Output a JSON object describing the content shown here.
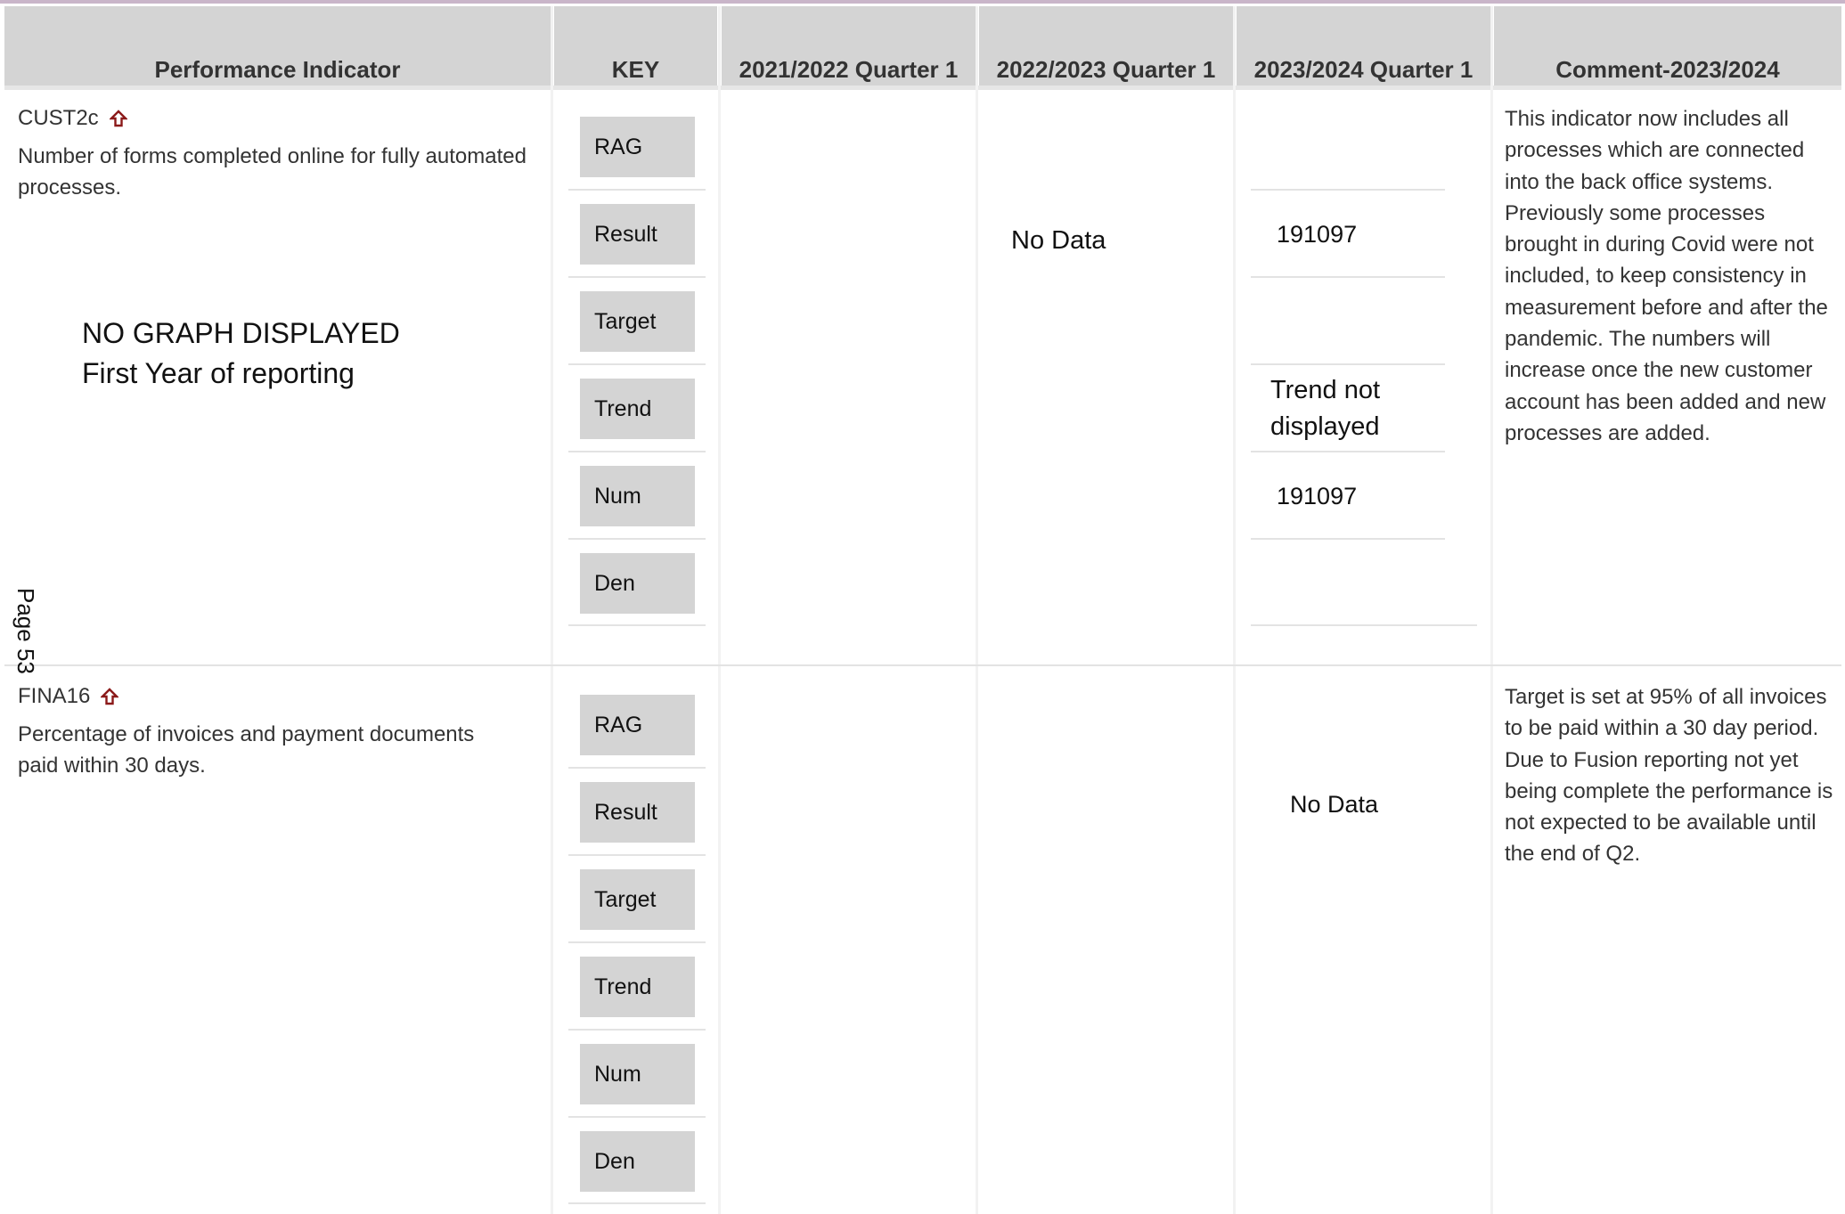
{
  "columns": [
    "Performance Indicator",
    "KEY",
    "2021/2022 Quarter 1",
    "2022/2023 Quarter 1",
    "2023/2024 Quarter 1",
    "Comment-2023/2024"
  ],
  "page_label": "Page 53",
  "key_labels": [
    "RAG",
    "Result",
    "Target",
    "Trend",
    "Num",
    "Den"
  ],
  "rows": [
    {
      "code": "CUST2c",
      "icon": "up-arrow-icon",
      "description": "Number of forms completed online for fully automated processes.",
      "graph_note_line1": "NO GRAPH DISPLAYED",
      "graph_note_line2": "First Year of reporting",
      "q1_2022_2023": "No Data",
      "q1_2023_2024": {
        "result": "191097",
        "trend_line1": "Trend not",
        "trend_line2": "displayed",
        "num": "191097"
      },
      "comment": "This indicator now includes all processes which are connected into the back office systems. Previously some processes brought in during Covid were not included, to keep consistency in measurement before and after the pandemic. The numbers will increase once the new customer account has been added and new processes are added."
    },
    {
      "code": "FINA16",
      "icon": "up-arrow-icon",
      "description": "Percentage of invoices and payment documents paid within 30 days.",
      "q1_2023_2024": "No Data",
      "comment": "Target is set at 95% of all invoices to be paid within a 30 day period. Due to Fusion reporting not yet being complete the performance is not expected to be available until the end of Q2."
    }
  ],
  "colors": {
    "header_bg": "#d4d4d4",
    "arrow": "#8b1a1a"
  }
}
